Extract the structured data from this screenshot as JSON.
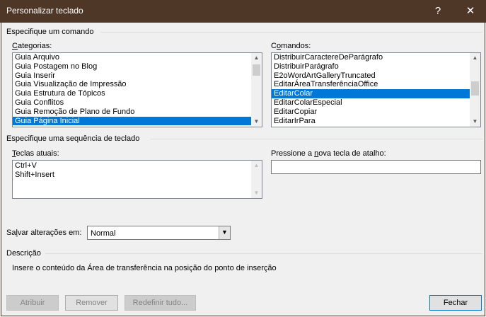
{
  "window": {
    "title": "Personalizar teclado",
    "help": "?",
    "close": "✕"
  },
  "command_group": {
    "label": "Especifique um comando",
    "categories_label": "Categorias:",
    "categories": [
      "Guia Arquivo",
      "Guia Postagem no Blog",
      "Guia Inserir",
      "Guia Visualização de Impressão",
      "Guia Estrutura de Tópicos",
      "Guia Conflitos",
      "Guia Remoção de Plano de Fundo",
      "Guia Página Inicial"
    ],
    "selected_category": "Guia Página Inicial",
    "commands_label": "Comandos:",
    "commands": [
      "DistribuirCaractereDeParágrafo",
      "DistribuirParágrafo",
      "E2oWordArtGalleryTruncated",
      "EditarÁreaTransferênciaOffice",
      "EditarColar",
      "EditarColarEspecial",
      "EditarCopiar",
      "EditarIrPara"
    ],
    "selected_command": "EditarColar"
  },
  "shortcut_group": {
    "label": "Especifique uma sequência de teclado",
    "current_keys_label": "Teclas atuais:",
    "current_keys": [
      "Ctrl+V",
      "Shift+Insert"
    ],
    "new_key_label": "Pressione a nova tecla de atalho:",
    "new_key_value": ""
  },
  "save_in": {
    "label": "Salvar alterações em:",
    "value": "Normal"
  },
  "description": {
    "label": "Descrição",
    "text": "Insere o conteúdo da Área de transferência na posição do ponto de inserção"
  },
  "buttons": {
    "assign": "Atribuir",
    "remove": "Remover",
    "reset_all": "Redefinir tudo...",
    "close": "Fechar"
  }
}
